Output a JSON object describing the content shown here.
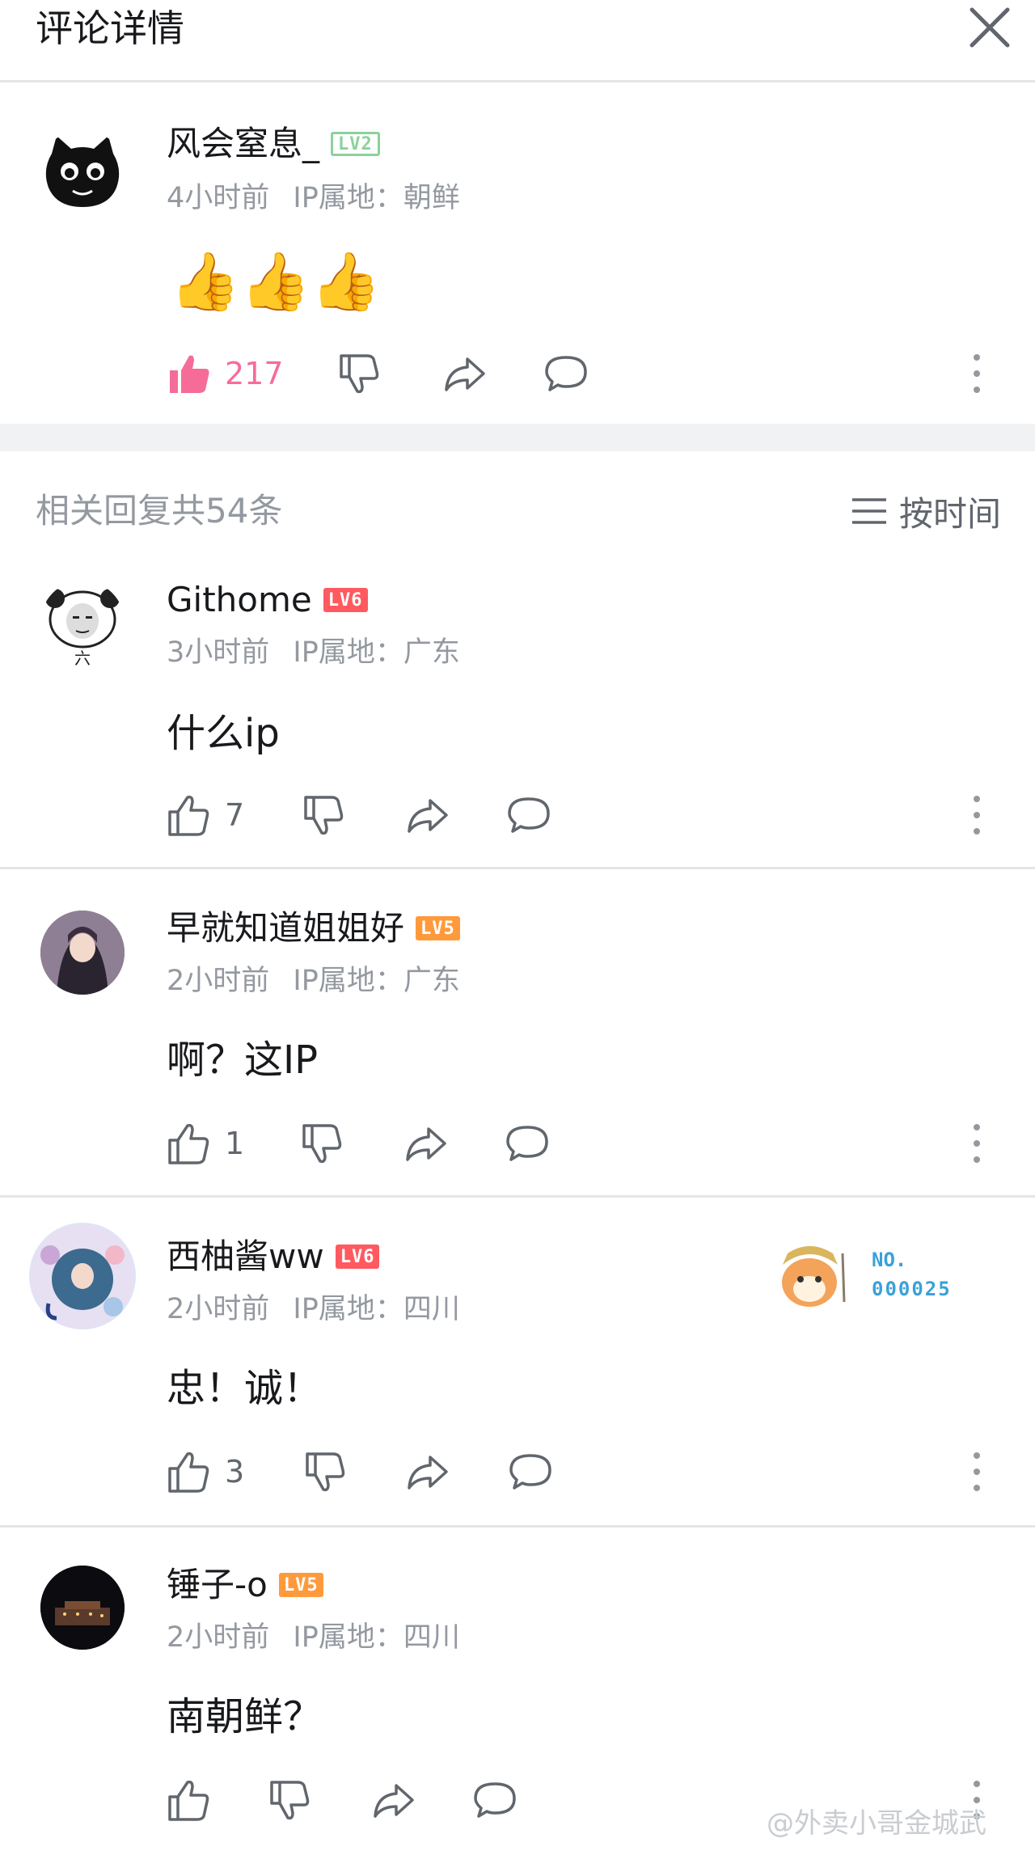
{
  "header": {
    "title": "评论详情"
  },
  "main_comment": {
    "username": "风会窒息_",
    "level": "LV2",
    "time": "4小时前",
    "ip_label": "IP属地：朝鲜",
    "content": "👍👍👍",
    "likes": "217"
  },
  "replies_section": {
    "title": "相关回复共54条",
    "sort_label": "按时间"
  },
  "replies": [
    {
      "username": "Githome",
      "level": "LV6",
      "time": "3小时前",
      "ip_label": "IP属地：广东",
      "content": "什么ip",
      "likes": "7",
      "avatar_caption": "六"
    },
    {
      "username": "早就知道姐姐好",
      "level": "LV5",
      "time": "2小时前",
      "ip_label": "IP属地：广东",
      "content": "啊？这IP",
      "likes": "1"
    },
    {
      "username": "西柚酱ww",
      "level": "LV6",
      "time": "2小时前",
      "ip_label": "IP属地：四川",
      "content": "忠！诚！",
      "likes": "3",
      "fan_badge": {
        "line1": "NO.",
        "line2": "000025"
      }
    },
    {
      "username": "锤子-o",
      "level": "LV5",
      "time": "2小时前",
      "ip_label": "IP属地：四川",
      "content": "南朝鲜？",
      "likes": ""
    }
  ],
  "watermark": "@外卖小哥金城武",
  "colors": {
    "like_active": "#f56c98",
    "icon": "#61666d",
    "meta": "#9499a0"
  },
  "icons": [
    "close-icon",
    "thumbs-up-icon",
    "thumbs-down-icon",
    "share-icon",
    "reply-icon",
    "more-icon",
    "sort-icon"
  ]
}
